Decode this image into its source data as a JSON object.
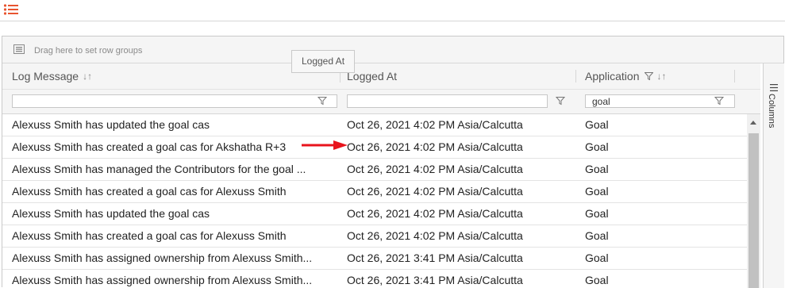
{
  "toolbar": {
    "menu_icon": "list-icon",
    "accent": "#e8542f"
  },
  "grid": {
    "group_panel_text": "Drag here to set row groups",
    "tooltip": "Logged At",
    "columns": [
      {
        "label": "Log Message",
        "sortable": true,
        "filter_icon": false
      },
      {
        "label": "Logged At",
        "sortable": false,
        "filter_icon": false
      },
      {
        "label": "Application",
        "sortable": true,
        "filter_icon": true
      }
    ],
    "filters": [
      "",
      "",
      "goal"
    ],
    "rows": [
      {
        "message": "Alexuss Smith has updated the goal cas",
        "logged_at": "Oct 26, 2021 4:02 PM Asia/Calcutta",
        "application": "Goal"
      },
      {
        "message": "Alexuss Smith has created a goal cas for Akshatha R+3",
        "logged_at": "Oct 26, 2021 4:02 PM Asia/Calcutta",
        "application": "Goal"
      },
      {
        "message": "Alexuss Smith has managed the Contributors for the goal ...",
        "logged_at": "Oct 26, 2021 4:02 PM Asia/Calcutta",
        "application": "Goal"
      },
      {
        "message": "Alexuss Smith has created a goal cas for Alexuss Smith",
        "logged_at": "Oct 26, 2021 4:02 PM Asia/Calcutta",
        "application": "Goal"
      },
      {
        "message": "Alexuss Smith has updated the goal cas",
        "logged_at": "Oct 26, 2021 4:02 PM Asia/Calcutta",
        "application": "Goal"
      },
      {
        "message": "Alexuss Smith has created a goal cas for Alexuss Smith",
        "logged_at": "Oct 26, 2021 4:02 PM Asia/Calcutta",
        "application": "Goal"
      },
      {
        "message": "Alexuss Smith has assigned ownership from Alexuss Smith...",
        "logged_at": "Oct 26, 2021 3:41 PM Asia/Calcutta",
        "application": "Goal"
      },
      {
        "message": "Alexuss Smith has assigned ownership from Alexuss Smith...",
        "logged_at": "Oct 26, 2021 3:41 PM Asia/Calcutta",
        "application": "Goal"
      }
    ],
    "side_panel_label": "Columns",
    "annotation_color": "#e8141c"
  }
}
